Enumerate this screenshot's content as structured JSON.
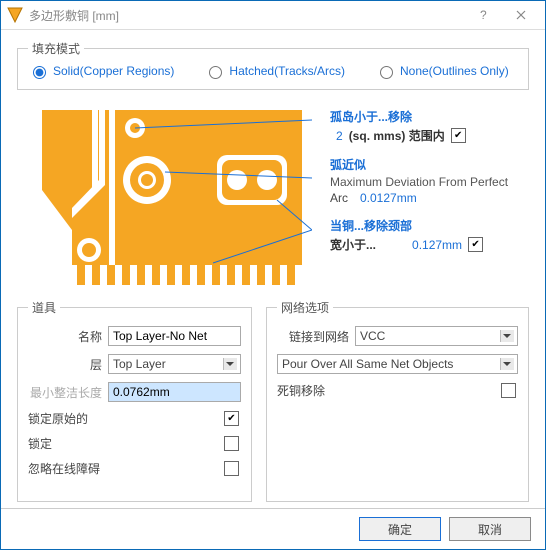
{
  "window": {
    "title": "多边形敷铜 [mm]"
  },
  "fill_mode": {
    "legend": "填充模式",
    "options": {
      "solid": "Solid(Copper Regions)",
      "hatched": "Hatched(Tracks/Arcs)",
      "none": "None(Outlines Only)"
    },
    "selected": "solid"
  },
  "side": {
    "island": {
      "title": "孤岛小于...移除",
      "value": "2",
      "unit": "(sq. mms) 范围内",
      "checked": true
    },
    "arc": {
      "title": "弧近似",
      "sub1": "Maximum Deviation From Perfect",
      "sub2_prefix": "Arc",
      "value": "0.0127mm"
    },
    "neck": {
      "title": "当铜...移除颈部",
      "sub_label": "宽小于...",
      "value": "0.127mm",
      "checked": true
    }
  },
  "props": {
    "legend": "道具",
    "name_label": "名称",
    "name_value": "Top Layer-No Net",
    "layer_label": "层",
    "layer_value": "Top Layer",
    "minlen_label": "最小整洁长度",
    "minlen_value": "0.0762mm",
    "lock_orig_label": "锁定原始的",
    "lock_orig_checked": true,
    "lock_label": "锁定",
    "lock_checked": false,
    "ignore_label": "忽略在线障碍",
    "ignore_checked": false
  },
  "net": {
    "legend": "网络选项",
    "connect_label": "链接到网络",
    "connect_value": "VCC",
    "pour_value": "Pour Over All Same Net Objects",
    "dead_label": "死铜移除",
    "dead_checked": false
  },
  "footer": {
    "ok": "确定",
    "cancel": "取消"
  }
}
